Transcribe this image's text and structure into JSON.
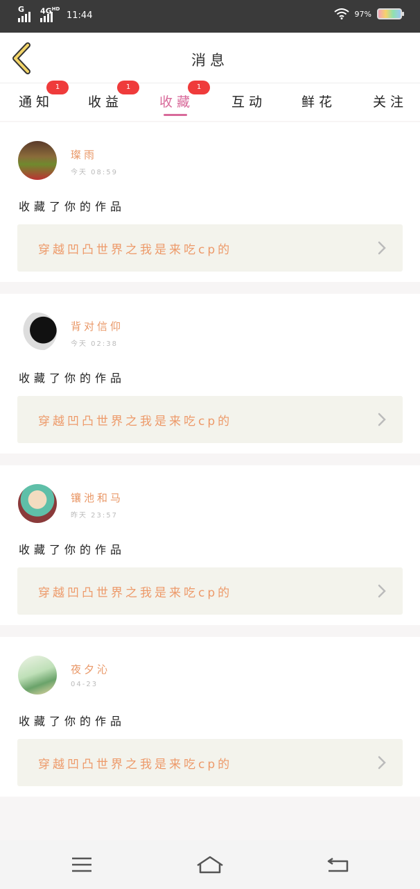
{
  "status_bar": {
    "network1": "G",
    "network2": "4G",
    "network2_sup": "HD",
    "time": "11:44",
    "battery": "97%"
  },
  "header": {
    "title": "消息",
    "back_icon": "chevron-left-icon"
  },
  "tabs": [
    {
      "label": "通知",
      "badge": "1",
      "active": false
    },
    {
      "label": "收益",
      "badge": "1",
      "active": false
    },
    {
      "label": "收藏",
      "badge": "1",
      "active": true
    },
    {
      "label": "互动",
      "badge": "",
      "active": false
    },
    {
      "label": "鲜花",
      "badge": "",
      "active": false
    },
    {
      "label": "关注",
      "badge": "",
      "active": false
    }
  ],
  "notifications": [
    {
      "user": "璨雨",
      "time": "今天 08:59",
      "action": "收藏了你的作品",
      "work_title": "穿越凹凸世界之我是来吃cp的"
    },
    {
      "user": "背对信仰",
      "time": "今天 02:38",
      "action": "收藏了你的作品",
      "work_title": "穿越凹凸世界之我是来吃cp的"
    },
    {
      "user": "镶池和马",
      "time": "昨天 23:57",
      "action": "收藏了你的作品",
      "work_title": "穿越凹凸世界之我是来吃cp的"
    },
    {
      "user": "夜夕沁",
      "time": "04-23",
      "action": "收藏了你的作品",
      "work_title": "穿越凹凸世界之我是来吃cp的"
    }
  ],
  "colors": {
    "accent": "#d86a9a",
    "username": "#e99868",
    "work_title": "#ed9a6a",
    "badge": "#ef3b3b",
    "work_bg": "#f3f3ec"
  },
  "nav": [
    "menu-icon",
    "home-icon",
    "back-icon"
  ]
}
